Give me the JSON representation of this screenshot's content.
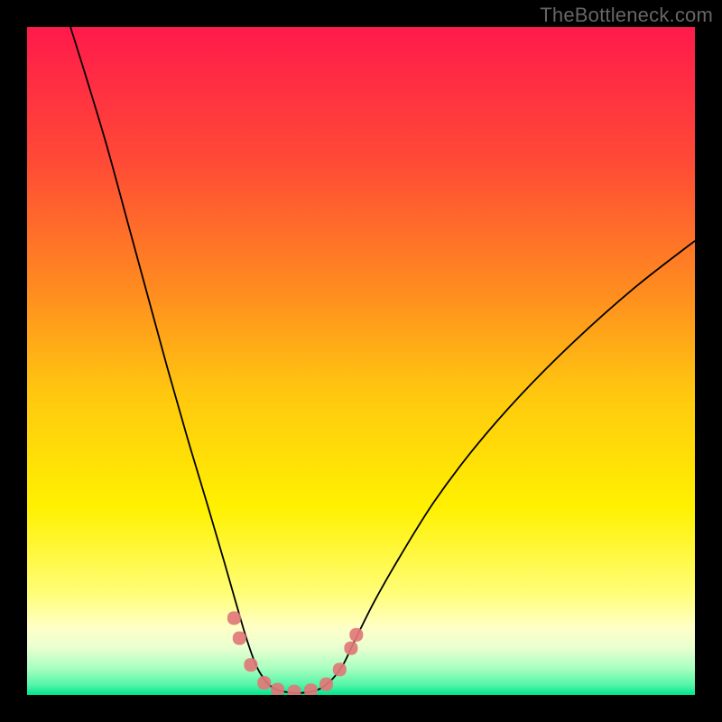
{
  "watermark": {
    "text": "TheBottleneck.com"
  },
  "chart_data": {
    "type": "line",
    "title": "",
    "xlabel": "",
    "ylabel": "",
    "xlim": [
      0,
      100
    ],
    "ylim": [
      0,
      100
    ],
    "grid": false,
    "legend": false,
    "background_gradient": {
      "stops": [
        {
          "pos": 0.0,
          "color": "#FF1A4B"
        },
        {
          "pos": 0.2,
          "color": "#FF4A36"
        },
        {
          "pos": 0.4,
          "color": "#FF8E1F"
        },
        {
          "pos": 0.55,
          "color": "#FFC80F"
        },
        {
          "pos": 0.72,
          "color": "#FFF100"
        },
        {
          "pos": 0.85,
          "color": "#FFFE7A"
        },
        {
          "pos": 0.9,
          "color": "#FFFFC8"
        },
        {
          "pos": 0.93,
          "color": "#E8FFD0"
        },
        {
          "pos": 0.96,
          "color": "#A8FFC0"
        },
        {
          "pos": 0.985,
          "color": "#55F5A8"
        },
        {
          "pos": 1.0,
          "color": "#00E58F"
        }
      ]
    },
    "series": [
      {
        "name": "bottleneck-curve",
        "color": "#000000",
        "width": 1.8,
        "type": "line",
        "points": [
          {
            "x": 6.5,
            "y": 100.0
          },
          {
            "x": 9.0,
            "y": 92.0
          },
          {
            "x": 12.0,
            "y": 82.0
          },
          {
            "x": 15.0,
            "y": 71.0
          },
          {
            "x": 18.0,
            "y": 60.0
          },
          {
            "x": 21.0,
            "y": 49.0
          },
          {
            "x": 24.0,
            "y": 38.5
          },
          {
            "x": 27.0,
            "y": 28.5
          },
          {
            "x": 29.5,
            "y": 20.0
          },
          {
            "x": 31.5,
            "y": 13.0
          },
          {
            "x": 33.0,
            "y": 8.0
          },
          {
            "x": 34.5,
            "y": 4.0
          },
          {
            "x": 36.5,
            "y": 1.3
          },
          {
            "x": 39.0,
            "y": 0.4
          },
          {
            "x": 42.0,
            "y": 0.4
          },
          {
            "x": 44.5,
            "y": 1.3
          },
          {
            "x": 47.0,
            "y": 4.0
          },
          {
            "x": 49.0,
            "y": 8.0
          },
          {
            "x": 52.0,
            "y": 14.0
          },
          {
            "x": 56.0,
            "y": 21.0
          },
          {
            "x": 61.0,
            "y": 29.0
          },
          {
            "x": 67.0,
            "y": 37.0
          },
          {
            "x": 74.0,
            "y": 45.0
          },
          {
            "x": 82.0,
            "y": 53.0
          },
          {
            "x": 91.0,
            "y": 61.0
          },
          {
            "x": 100.0,
            "y": 68.0
          }
        ]
      },
      {
        "name": "threshold-markers",
        "color": "#E07878",
        "type": "scatter",
        "marker_size": 5,
        "points": [
          {
            "x": 31.0,
            "y": 11.5
          },
          {
            "x": 31.8,
            "y": 8.5
          },
          {
            "x": 33.5,
            "y": 4.5
          },
          {
            "x": 35.5,
            "y": 1.8
          },
          {
            "x": 37.5,
            "y": 0.8
          },
          {
            "x": 40.0,
            "y": 0.5
          },
          {
            "x": 42.5,
            "y": 0.7
          },
          {
            "x": 44.8,
            "y": 1.6
          },
          {
            "x": 46.8,
            "y": 3.8
          },
          {
            "x": 48.5,
            "y": 7.0
          },
          {
            "x": 49.3,
            "y": 9.0
          }
        ]
      }
    ]
  }
}
